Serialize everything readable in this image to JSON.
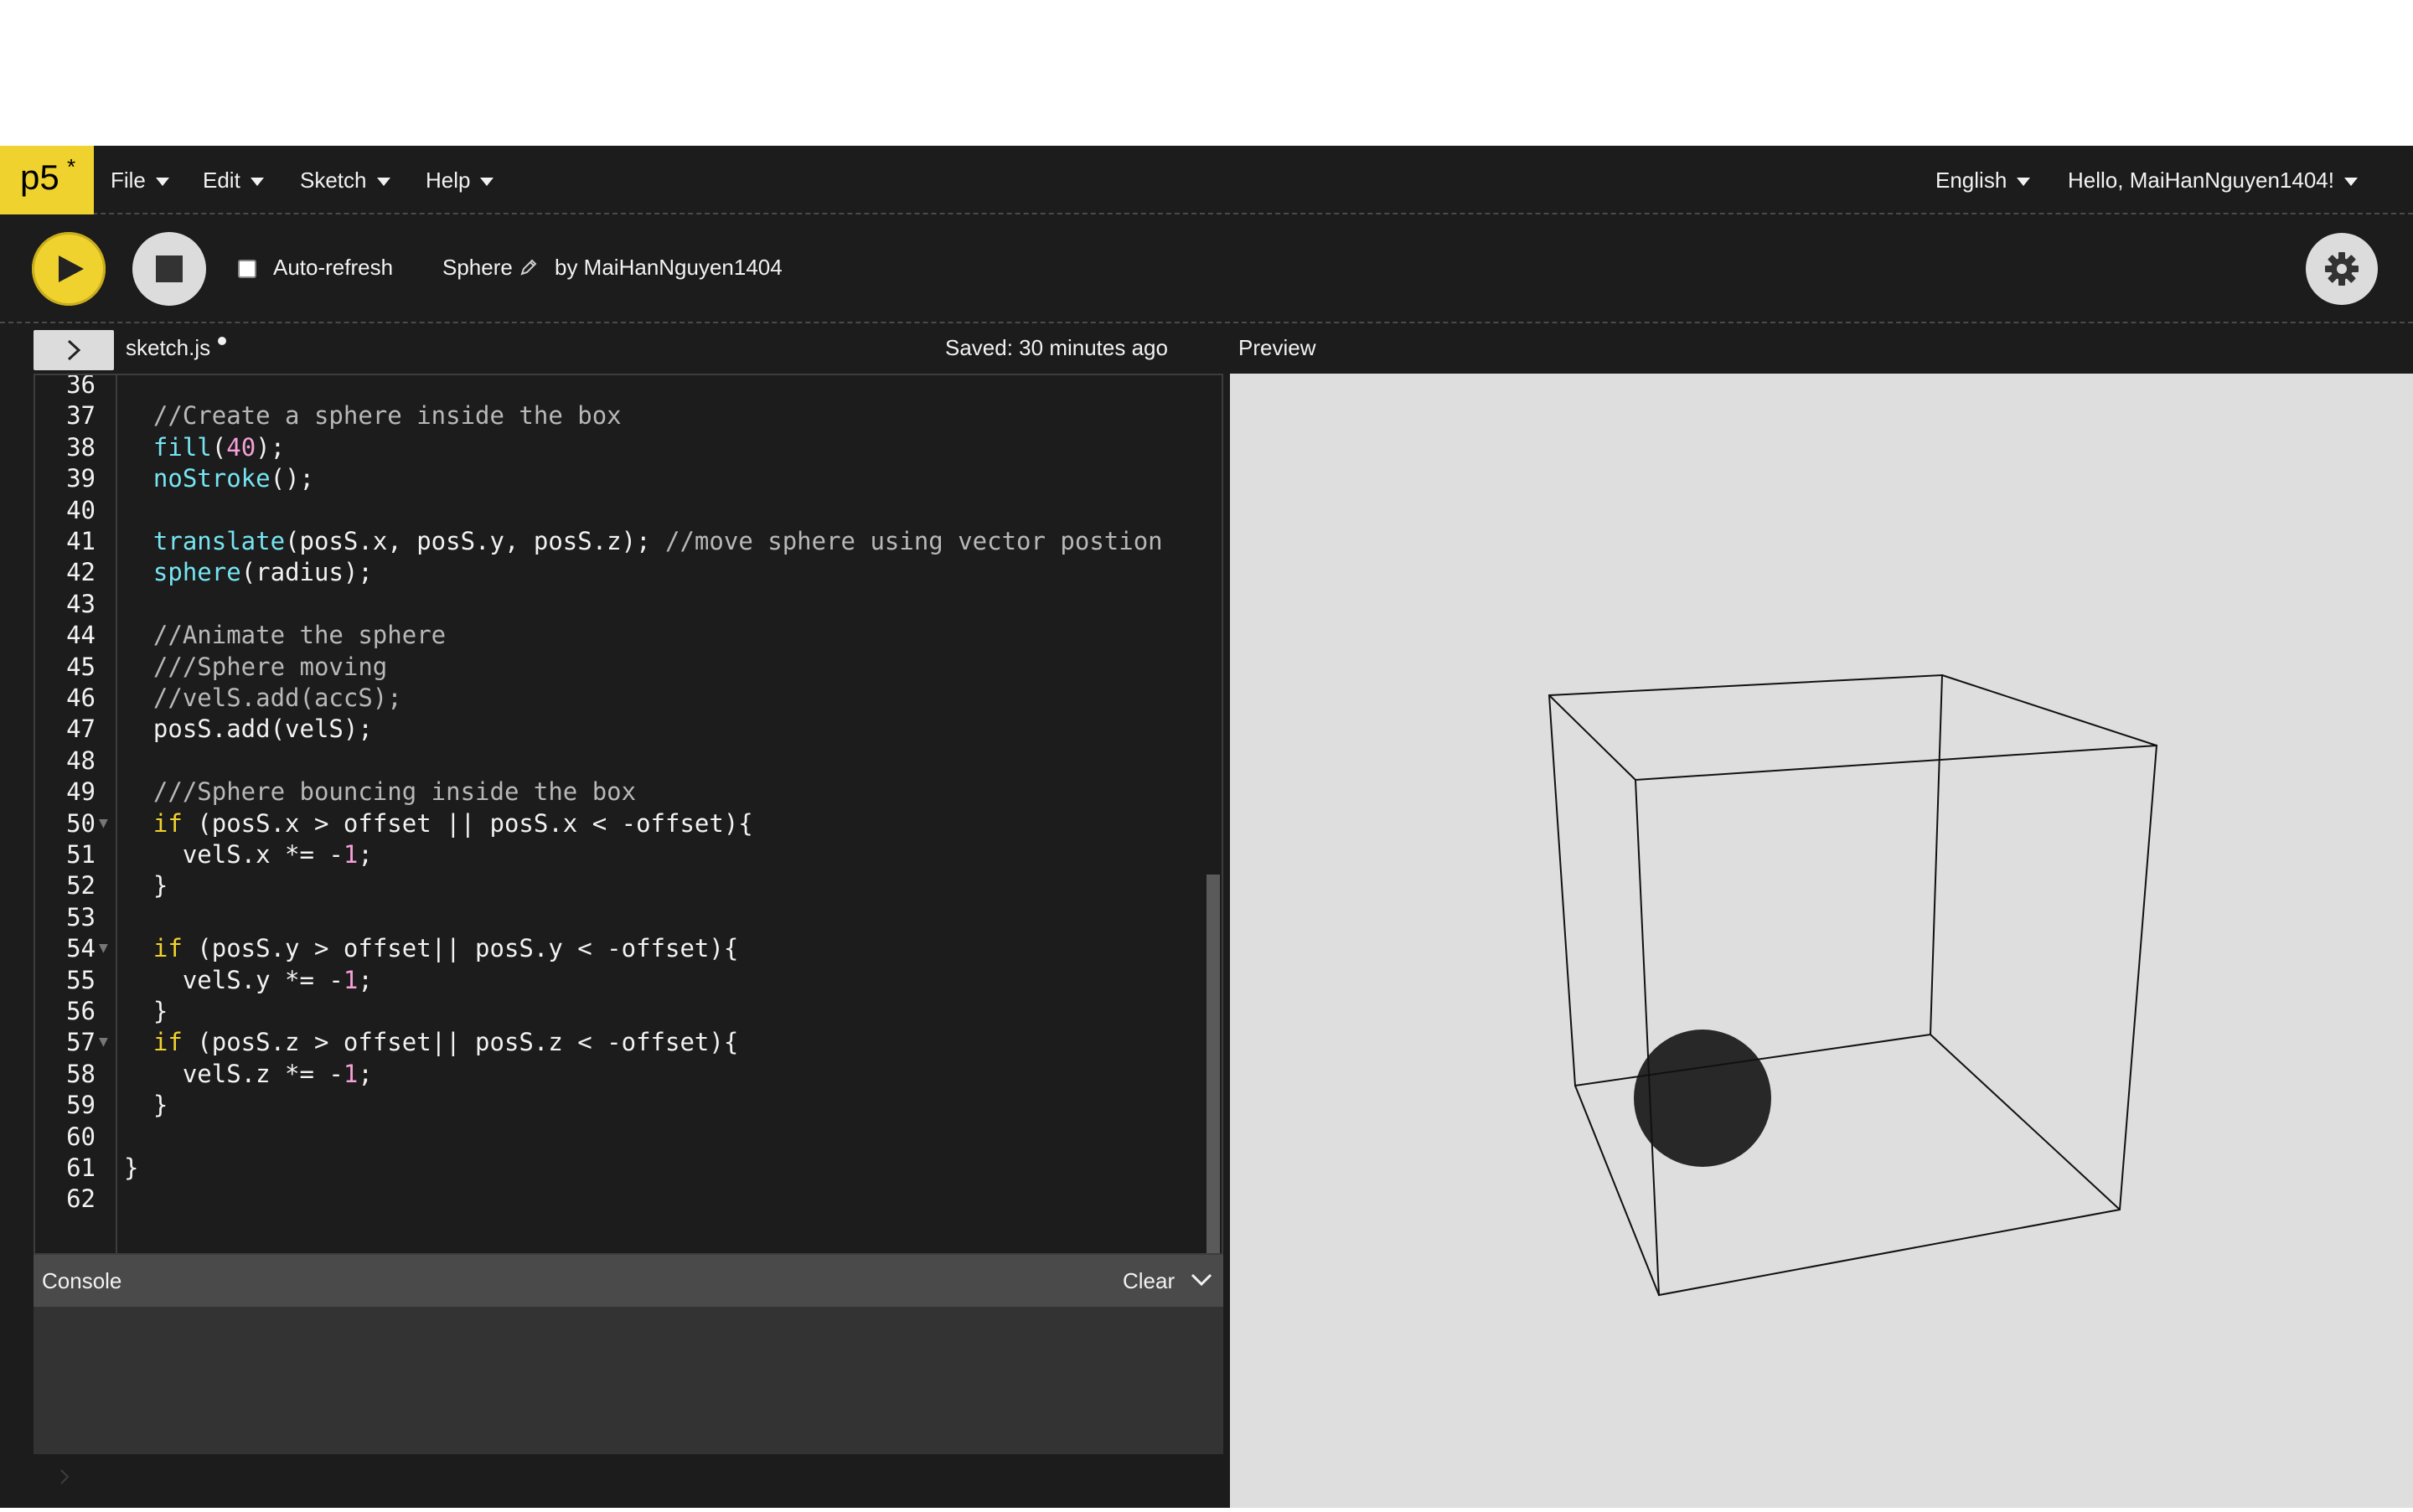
{
  "nav": {
    "logo": "p5",
    "logo_mark": "*",
    "menus": [
      {
        "label": "File"
      },
      {
        "label": "Edit"
      },
      {
        "label": "Sketch"
      },
      {
        "label": "Help"
      }
    ],
    "language": "English",
    "user_greeting": "Hello, MaiHanNguyen1404!"
  },
  "toolbar": {
    "play_icon": "play-icon",
    "stop_icon": "stop-icon",
    "autorefresh_label": "Auto-refresh",
    "autorefresh_checked": false,
    "sketch_name": "Sketch",
    "sketch_title": "Sphere",
    "owner": "by MaiHanNguyen1404",
    "settings_icon": "gear-icon"
  },
  "tabbar": {
    "file_name": "sketch.js",
    "saved_status": "Saved: 30 minutes ago",
    "preview_label": "Preview"
  },
  "editor": {
    "lines": [
      {
        "n": "36",
        "segments": []
      },
      {
        "n": "37",
        "segments": [
          {
            "t": "  //Create a sphere inside the box",
            "c": "cm"
          }
        ]
      },
      {
        "n": "38",
        "segments": [
          {
            "t": "  ",
            "c": ""
          },
          {
            "t": "fill",
            "c": "fn"
          },
          {
            "t": "(",
            "c": ""
          },
          {
            "t": "40",
            "c": "num"
          },
          {
            "t": ");",
            "c": ""
          }
        ]
      },
      {
        "n": "39",
        "segments": [
          {
            "t": "  ",
            "c": ""
          },
          {
            "t": "noStroke",
            "c": "fn"
          },
          {
            "t": "();",
            "c": ""
          }
        ]
      },
      {
        "n": "40",
        "segments": []
      },
      {
        "n": "41",
        "segments": [
          {
            "t": "  ",
            "c": ""
          },
          {
            "t": "translate",
            "c": "fn"
          },
          {
            "t": "(posS.x, posS.y, posS.z); ",
            "c": ""
          },
          {
            "t": "//move sphere using vector postion",
            "c": "cm"
          }
        ]
      },
      {
        "n": "42",
        "segments": [
          {
            "t": "  ",
            "c": ""
          },
          {
            "t": "sphere",
            "c": "fn"
          },
          {
            "t": "(radius);",
            "c": ""
          }
        ]
      },
      {
        "n": "43",
        "segments": []
      },
      {
        "n": "44",
        "segments": [
          {
            "t": "  //Animate the sphere",
            "c": "cm"
          }
        ]
      },
      {
        "n": "45",
        "segments": [
          {
            "t": "  ///Sphere moving",
            "c": "cm"
          }
        ]
      },
      {
        "n": "46",
        "segments": [
          {
            "t": "  //velS.add(accS);",
            "c": "cm"
          }
        ]
      },
      {
        "n": "47",
        "segments": [
          {
            "t": "  posS.add(velS);",
            "c": ""
          }
        ]
      },
      {
        "n": "48",
        "segments": []
      },
      {
        "n": "49",
        "segments": [
          {
            "t": "  ///Sphere bouncing inside the box",
            "c": "cm"
          }
        ]
      },
      {
        "n": "50",
        "fold": true,
        "segments": [
          {
            "t": "  ",
            "c": ""
          },
          {
            "t": "if",
            "c": "kw"
          },
          {
            "t": " (posS.x > offset || posS.x < -offset){",
            "c": ""
          }
        ]
      },
      {
        "n": "51",
        "segments": [
          {
            "t": "    velS.x *= -",
            "c": ""
          },
          {
            "t": "1",
            "c": "num"
          },
          {
            "t": ";",
            "c": ""
          }
        ]
      },
      {
        "n": "52",
        "segments": [
          {
            "t": "  }",
            "c": ""
          }
        ]
      },
      {
        "n": "53",
        "segments": []
      },
      {
        "n": "54",
        "fold": true,
        "segments": [
          {
            "t": "  ",
            "c": ""
          },
          {
            "t": "if",
            "c": "kw"
          },
          {
            "t": " (posS.y > offset|| posS.y < -offset){",
            "c": ""
          }
        ]
      },
      {
        "n": "55",
        "segments": [
          {
            "t": "    velS.y *= -",
            "c": ""
          },
          {
            "t": "1",
            "c": "num"
          },
          {
            "t": ";",
            "c": ""
          }
        ]
      },
      {
        "n": "56",
        "segments": [
          {
            "t": "  }",
            "c": ""
          }
        ]
      },
      {
        "n": "57",
        "fold": true,
        "segments": [
          {
            "t": "  ",
            "c": ""
          },
          {
            "t": "if",
            "c": "kw"
          },
          {
            "t": " (posS.z > offset|| posS.z < -offset){",
            "c": ""
          }
        ]
      },
      {
        "n": "58",
        "segments": [
          {
            "t": "    velS.z *= -",
            "c": ""
          },
          {
            "t": "1",
            "c": "num"
          },
          {
            "t": ";",
            "c": ""
          }
        ]
      },
      {
        "n": "59",
        "segments": [
          {
            "t": "  }",
            "c": ""
          }
        ]
      },
      {
        "n": "60",
        "segments": []
      },
      {
        "n": "61",
        "segments": [
          {
            "t": "}",
            "c": ""
          }
        ]
      },
      {
        "n": "62",
        "segments": []
      }
    ]
  },
  "console": {
    "title": "Console",
    "clear_label": "Clear"
  },
  "colors": {
    "accent": "#f0d22e",
    "background": "#1c1c1c",
    "function": "#76e5f2",
    "keyword": "#f0d22e",
    "number": "#f5a0d8",
    "comment": "#b8b8b8",
    "preview_bg": "#dedede",
    "sphere": "#282828"
  }
}
